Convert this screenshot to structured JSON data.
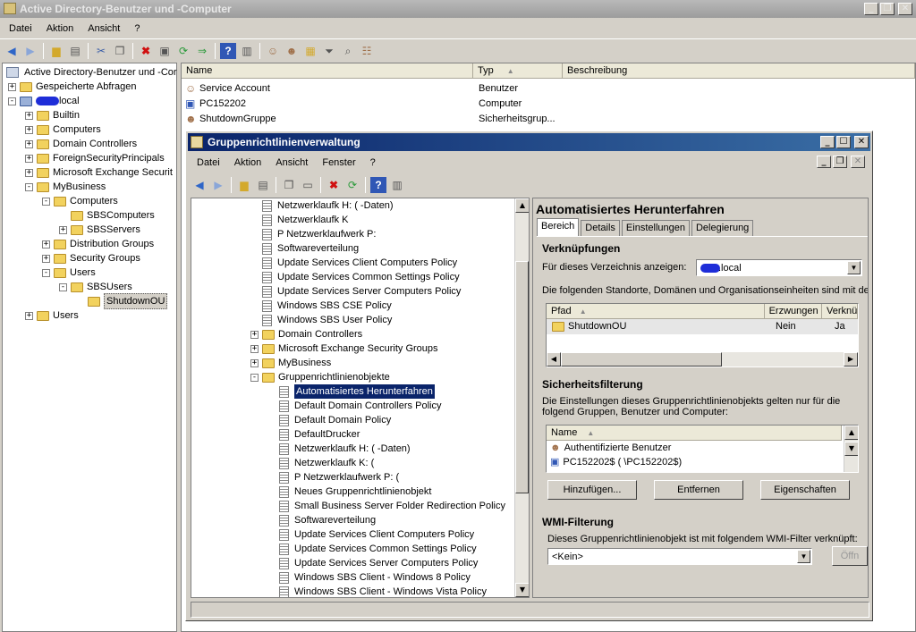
{
  "main_window": {
    "title": "Active Directory-Benutzer und -Computer",
    "menu": [
      "Datei",
      "Aktion",
      "Ansicht",
      "?"
    ],
    "tree_root": "Active Directory-Benutzer und -Cor",
    "tree": [
      {
        "label": "Gespeicherte Abfragen",
        "level": 1,
        "pm": "+"
      },
      {
        "label": "local",
        "level": 1,
        "pm": "-",
        "redacted_prefix": true
      },
      {
        "label": "Builtin",
        "level": 2,
        "pm": "+"
      },
      {
        "label": "Computers",
        "level": 2,
        "pm": "+"
      },
      {
        "label": "Domain Controllers",
        "level": 2,
        "pm": "+"
      },
      {
        "label": "ForeignSecurityPrincipals",
        "level": 2,
        "pm": "+"
      },
      {
        "label": "Microsoft Exchange Securit",
        "level": 2,
        "pm": "+"
      },
      {
        "label": "MyBusiness",
        "level": 2,
        "pm": "-"
      },
      {
        "label": "Computers",
        "level": 3,
        "pm": "-"
      },
      {
        "label": "SBSComputers",
        "level": 4,
        "pm": ""
      },
      {
        "label": "SBSServers",
        "level": 4,
        "pm": "+"
      },
      {
        "label": "Distribution Groups",
        "level": 3,
        "pm": "+"
      },
      {
        "label": "Security Groups",
        "level": 3,
        "pm": "+"
      },
      {
        "label": "Users",
        "level": 3,
        "pm": "-"
      },
      {
        "label": "SBSUsers",
        "level": 4,
        "pm": "-"
      },
      {
        "label": "ShutdownOU",
        "level": 5,
        "pm": "",
        "selected": true
      },
      {
        "label": "Users",
        "level": 1,
        "pm": "+",
        "indent_override": 2
      }
    ],
    "list_columns": [
      "Name",
      "Typ",
      "Beschreibung"
    ],
    "list_rows": [
      {
        "name": "Service Account",
        "type": "Benutzer"
      },
      {
        "name": "PC152202",
        "type": "Computer"
      },
      {
        "name": "ShutdownGruppe",
        "type": "Sicherheitsgrup..."
      }
    ]
  },
  "gpm_window": {
    "title": "Gruppenrichtlinienverwaltung",
    "menu": [
      "Datei",
      "Aktion",
      "Ansicht",
      "Fenster",
      "?"
    ],
    "tree": [
      {
        "label": "Netzwerklaufk H: (    -Daten)",
        "level": 1,
        "pm": "",
        "kind": "gpo-link"
      },
      {
        "label": "Netzwerklaufk K",
        "level": 1,
        "pm": "",
        "kind": "gpo-link"
      },
      {
        "label": "P Netzwerklaufwerk P:",
        "level": 1,
        "pm": "",
        "kind": "gpo-link"
      },
      {
        "label": "Softwareverteilung",
        "level": 1,
        "pm": "",
        "kind": "gpo-link"
      },
      {
        "label": "Update Services Client Computers Policy",
        "level": 1,
        "pm": "",
        "kind": "gpo-link"
      },
      {
        "label": "Update Services Common Settings Policy",
        "level": 1,
        "pm": "",
        "kind": "gpo-link"
      },
      {
        "label": "Update Services Server Computers Policy",
        "level": 1,
        "pm": "",
        "kind": "gpo-link"
      },
      {
        "label": "Windows SBS CSE Policy",
        "level": 1,
        "pm": "",
        "kind": "gpo-link"
      },
      {
        "label": "Windows SBS User Policy",
        "level": 1,
        "pm": "",
        "kind": "gpo-link"
      },
      {
        "label": "Domain Controllers",
        "level": 0,
        "pm": "+",
        "kind": "folder"
      },
      {
        "label": "Microsoft Exchange Security Groups",
        "level": 0,
        "pm": "+",
        "kind": "folder"
      },
      {
        "label": "MyBusiness",
        "level": 0,
        "pm": "+",
        "kind": "folder"
      },
      {
        "label": "Gruppenrichtlinienobjekte",
        "level": 0,
        "pm": "-",
        "kind": "folder"
      },
      {
        "label": "Automatisiertes Herunterfahren",
        "level": 1,
        "pm": "",
        "kind": "gpo",
        "selected": true
      },
      {
        "label": "Default Domain Controllers Policy",
        "level": 1,
        "pm": "",
        "kind": "gpo"
      },
      {
        "label": "Default Domain Policy",
        "level": 1,
        "pm": "",
        "kind": "gpo"
      },
      {
        "label": "DefaultDrucker",
        "level": 1,
        "pm": "",
        "kind": "gpo"
      },
      {
        "label": "Netzwerklaufk H: (     -Daten)",
        "level": 1,
        "pm": "",
        "kind": "gpo"
      },
      {
        "label": "Netzwerklaufk K: (",
        "level": 1,
        "pm": "",
        "kind": "gpo"
      },
      {
        "label": "P Netzwerklaufwerk P: (",
        "level": 1,
        "pm": "",
        "kind": "gpo"
      },
      {
        "label": "Neues Gruppenrichtlinienobjekt",
        "level": 1,
        "pm": "",
        "kind": "gpo"
      },
      {
        "label": "Small Business Server Folder Redirection Policy",
        "level": 1,
        "pm": "",
        "kind": "gpo"
      },
      {
        "label": "Softwareverteilung",
        "level": 1,
        "pm": "",
        "kind": "gpo"
      },
      {
        "label": "Update Services Client Computers Policy",
        "level": 1,
        "pm": "",
        "kind": "gpo"
      },
      {
        "label": "Update Services Common Settings Policy",
        "level": 1,
        "pm": "",
        "kind": "gpo"
      },
      {
        "label": "Update Services Server Computers Policy",
        "level": 1,
        "pm": "",
        "kind": "gpo"
      },
      {
        "label": "Windows SBS Client - Windows 8 Policy",
        "level": 1,
        "pm": "",
        "kind": "gpo"
      },
      {
        "label": "Windows SBS Client - Windows Vista Policy",
        "level": 1,
        "pm": "",
        "kind": "gpo"
      }
    ],
    "detail": {
      "heading": "Automatisiertes Herunterfahren",
      "tabs": [
        "Bereich",
        "Details",
        "Einstellungen",
        "Delegierung"
      ],
      "links_heading": "Verknüpfungen",
      "show_label": "Für dieses Verzeichnis anzeigen:",
      "show_value": ".local",
      "links_desc": "Die folgenden Standorte, Domänen und Organisationseinheiten sind mit der",
      "links_columns": [
        "Pfad",
        "Erzwungen",
        "Verknü"
      ],
      "links_row": {
        "path": "ShutdownOU",
        "enforced": "Nein",
        "linked": "Ja"
      },
      "security_heading": "Sicherheitsfilterung",
      "security_desc": "Die Einstellungen dieses Gruppenrichtlinienobjekts gelten nur für die folgend Gruppen, Benutzer und Computer:",
      "security_column": "Name",
      "security_rows": [
        "Authentifizierte Benutzer",
        "PC152202$ (    \\PC152202$)"
      ],
      "buttons": [
        "Hinzufügen...",
        "Entfernen",
        "Eigenschaften"
      ],
      "wmi_heading": "WMI-Filterung",
      "wmi_desc": "Dieses Gruppenrichtlinienobjekt ist mit folgendem WMI-Filter verknüpft:",
      "wmi_value": "<Kein>",
      "wmi_button": "Öffn"
    }
  }
}
